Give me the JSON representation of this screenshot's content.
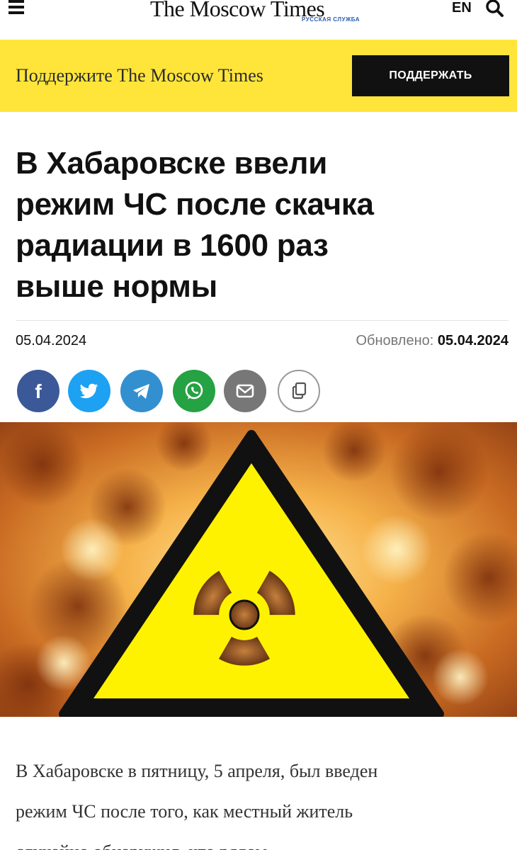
{
  "header": {
    "logo_text": "The Moscow Times",
    "logo_subtitle": "РУССКАЯ СЛУЖБА",
    "lang": "EN",
    "menu_icon": "hamburger-icon",
    "search_icon": "search-icon"
  },
  "support": {
    "text": "Поддержите The Moscow Times",
    "button_label": "ПОДДЕРЖАТЬ",
    "background": "#ffe53a"
  },
  "article": {
    "headline_lines": [
      "В Хабаровске ввели",
      "режим ЧС после скачка",
      "радиации в 1600 раз",
      "выше нормы"
    ],
    "date": "05.04.2024",
    "updated_label": "Обновлено:",
    "updated_value": "05.04.2024",
    "body_lines": [
      "В Хабаровске в пятницу, 5 апреля, был введен",
      "режим ЧС после того, как местный житель",
      "случайно обнаружил, что рядом"
    ]
  },
  "share_buttons": [
    {
      "icon": "facebook-icon",
      "color": "#3b5998"
    },
    {
      "icon": "twitter-icon",
      "color": "#1da1f2"
    },
    {
      "icon": "telegram-icon",
      "color": "#3390d0"
    },
    {
      "icon": "whatsapp-icon",
      "color": "#25a244"
    },
    {
      "icon": "mail-icon",
      "color": "#777777"
    },
    {
      "icon": "copy-icon",
      "color": "#ffffff"
    }
  ],
  "hero_image": {
    "icon": "radiation-hazard-icon"
  }
}
